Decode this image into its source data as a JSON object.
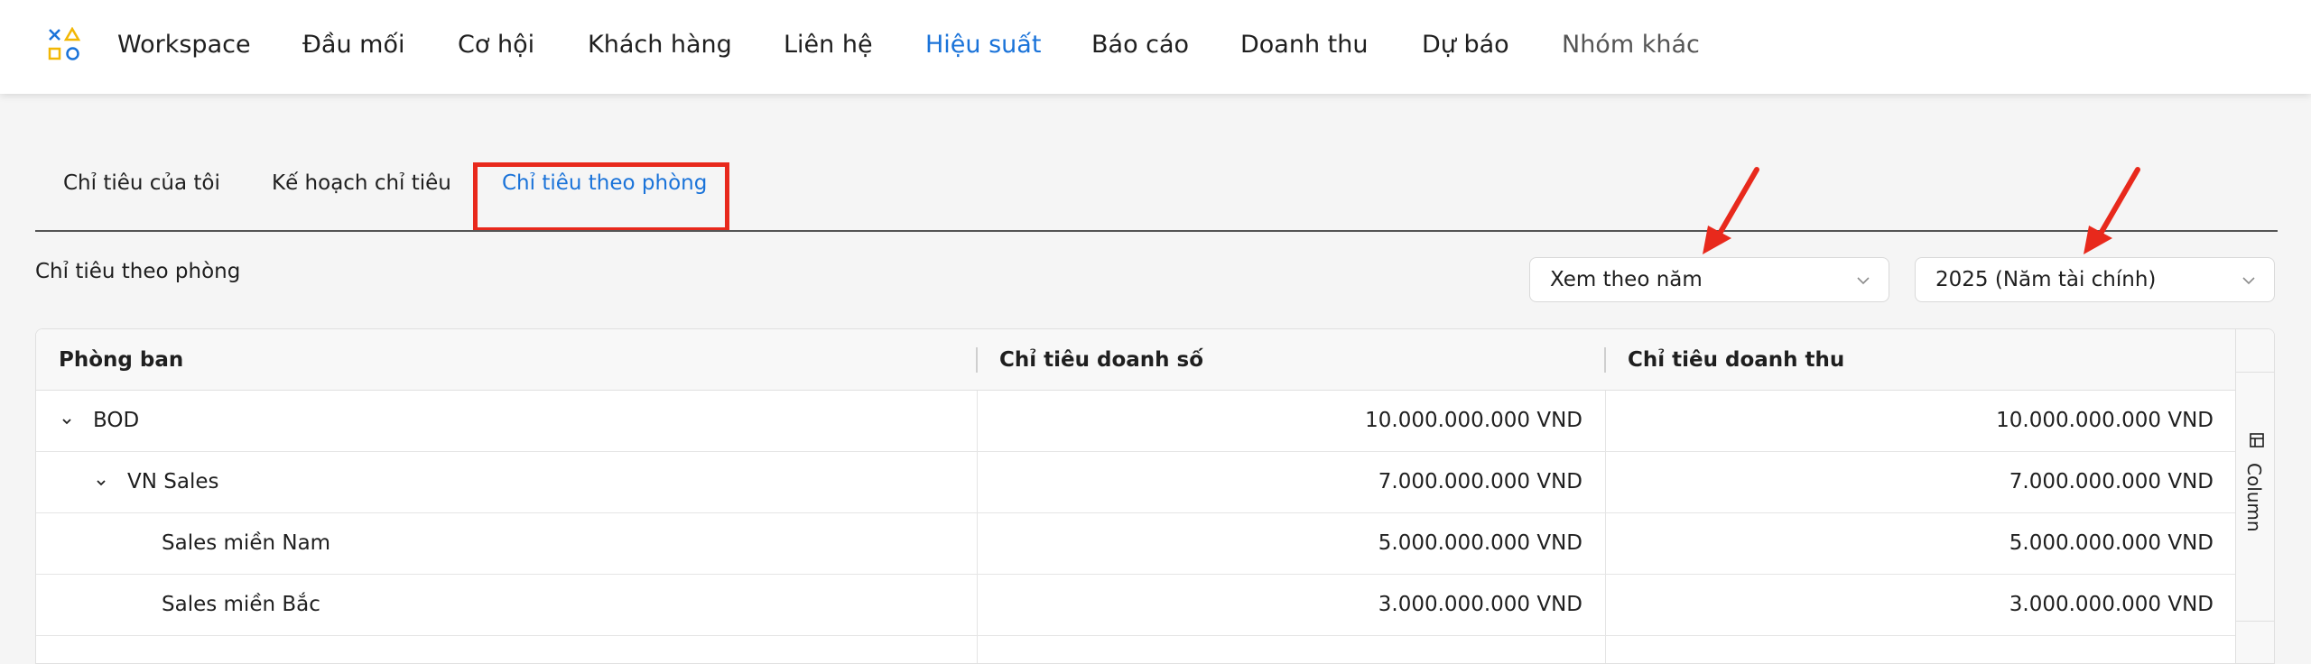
{
  "nav": {
    "items": [
      {
        "label": "Workspace"
      },
      {
        "label": "Đầu mối"
      },
      {
        "label": "Cơ hội"
      },
      {
        "label": "Khách hàng"
      },
      {
        "label": "Liên hệ"
      },
      {
        "label": "Hiệu suất",
        "active": true
      },
      {
        "label": "Báo cáo"
      },
      {
        "label": "Doanh thu"
      },
      {
        "label": "Dự báo"
      },
      {
        "label": "Nhóm khác"
      }
    ]
  },
  "tabs": [
    {
      "label": "Chỉ tiêu của tôi"
    },
    {
      "label": "Kế hoạch chỉ tiêu"
    },
    {
      "label": "Chỉ tiêu theo phòng",
      "active": true
    }
  ],
  "section_title": "Chỉ tiêu theo phòng",
  "filters": {
    "view_mode": "Xem theo năm",
    "fiscal_year": "2025 (Năm tài chính)"
  },
  "table": {
    "columns": [
      "Phòng ban",
      "Chỉ tiêu doanh số",
      "Chỉ tiêu doanh thu"
    ],
    "rows": [
      {
        "name": "BOD",
        "sales": "10.000.000.000 VND",
        "revenue": "10.000.000.000 VND"
      },
      {
        "name": "VN Sales",
        "sales": "7.000.000.000 VND",
        "revenue": "7.000.000.000 VND"
      },
      {
        "name": "Sales miền Nam",
        "sales": "5.000.000.000 VND",
        "revenue": "5.000.000.000 VND"
      },
      {
        "name": "Sales miền Bắc",
        "sales": "3.000.000.000 VND",
        "revenue": "3.000.000.000 VND"
      }
    ],
    "side_panel_label": "Column"
  },
  "colors": {
    "accent": "#1a73d9",
    "highlight": "#e8291c"
  }
}
